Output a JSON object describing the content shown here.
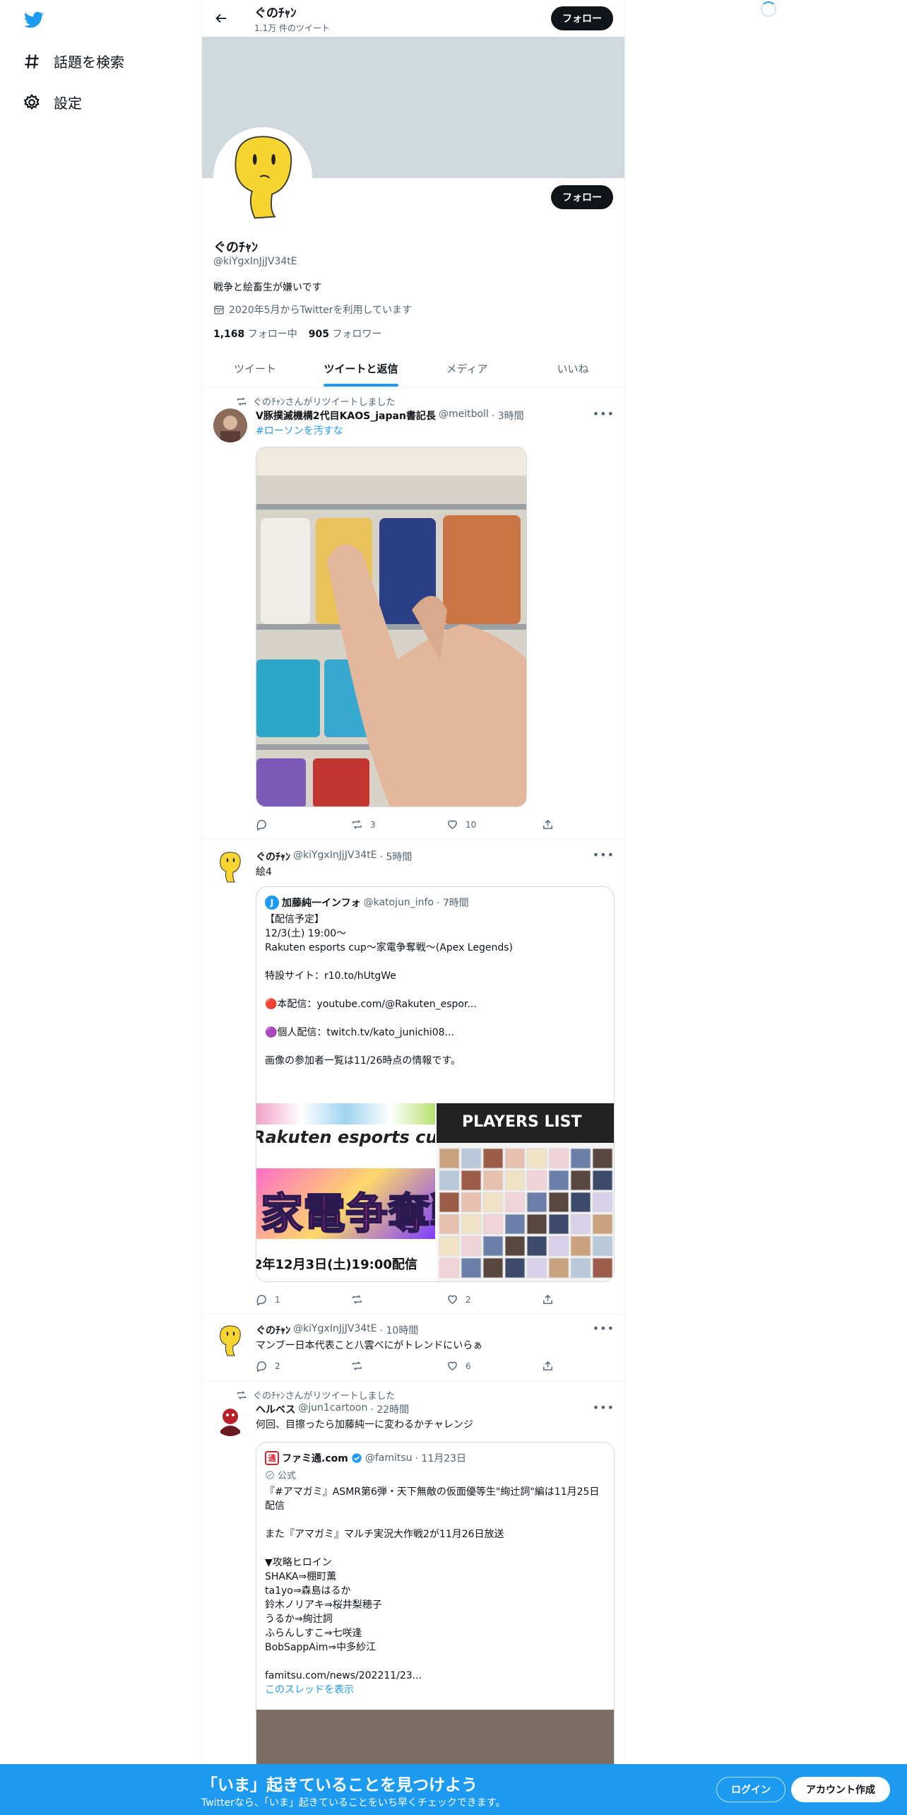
{
  "nav": {
    "explore": "話題を検索",
    "settings": "設定"
  },
  "header": {
    "name": "ぐのﾁｬﾝ",
    "tweet_count": "1.1万 件のツイート",
    "follow": "フォロー"
  },
  "profile": {
    "name": "ぐのﾁｬﾝ",
    "handle": "@kiYgxInJjJV34tE",
    "bio": "戦争と絵畜生が嫌いです",
    "joined": "2020年5月からTwitterを利用しています",
    "following_count": "1,168",
    "following_label": "フォロー中",
    "followers_count": "905",
    "followers_label": "フォロワー",
    "follow": "フォロー"
  },
  "tabs": [
    "ツイート",
    "ツイートと返信",
    "メディア",
    "いいね"
  ],
  "tweets": [
    {
      "retweeted_by": "ぐのﾁｬﾝさんがリツイートしました",
      "name": "V豚撲滅機構2代目KAOS_japan書記長",
      "handle": "@meitboll",
      "time": "· 3時間",
      "text": "#ローソンを汚すな",
      "replies": "",
      "retweets": "3",
      "likes": "10"
    },
    {
      "name": "ぐのﾁｬﾝ",
      "handle": "@kiYgxInJjJV34tE",
      "time": "· 5時間",
      "text": "絵4",
      "quote": {
        "name": "加藤純一インフォ",
        "handle": "@katojun_info",
        "time": "· 7時間",
        "text": "【配信予定】\n12/3(土) 19:00〜\nRakuten esports cup～家電争奪戦～(Apex Legends)\n\n特設サイト：r10.to/hUtgWe\n\n🔴本配信：youtube.com/@Rakuten_espor...\n\n🟣個人配信：twitch.tv/kato_junichi08...\n\n画像の参加者一覧は11/26時点の情報です。",
        "img1_top": "Rakuten esports cup",
        "img1_mid": "家電争奪戦",
        "img1_bottom": "2年12月3日(土)19:00配信",
        "img2_title": "PLAYERS LIST"
      },
      "replies": "1",
      "retweets": "",
      "likes": "2"
    },
    {
      "name": "ぐのﾁｬﾝ",
      "handle": "@kiYgxInJjJV34tE",
      "time": "· 10時間",
      "text": "マンブー日本代表こと八雲べにがトレンドにいらぁ",
      "replies": "2",
      "retweets": "",
      "likes": "6"
    },
    {
      "retweeted_by": "ぐのﾁｬﾝさんがリツイートしました",
      "name": "ヘルベス",
      "handle": "@jun1cartoon",
      "time": "· 22時間",
      "text": "何回、目擦ったら加藤純一に変わるかチャレンジ",
      "quote": {
        "name": "ファミ通.com",
        "handle": "@famitsu",
        "time": "· 11月23日",
        "label": "公式",
        "text": "『#アマガミ』ASMR第6弾・天下無敵の仮面優等生\"絢辻詞\"編は11月25日配信\n\nまた『アマガミ』マルチ実況大作戦2が11月26日放送\n\n▼攻略ヒロイン\nSHAKA⇒棚町薫\nta1yo⇒森島はるか\n鈴木ノリアキ⇒桜井梨穂子\nうるか⇒絢辻詞\nふらんしすこ⇒七咲逢\nBobSappAim⇒中多紗江\n\n famitsu.com/news/202211/23...",
        "thread": "このスレッドを表示"
      }
    }
  ],
  "bottom": {
    "title": "「いま」起きていることを見つけよう",
    "sub": "Twitterなら、「いま」起きていることをいち早くチェックできます。",
    "login": "ログイン",
    "signup": "アカウント作成"
  },
  "colors": {
    "accent": "#1d9bf0",
    "dark": "#0f1419",
    "muted": "#536471",
    "banner": "#cfd9de"
  }
}
